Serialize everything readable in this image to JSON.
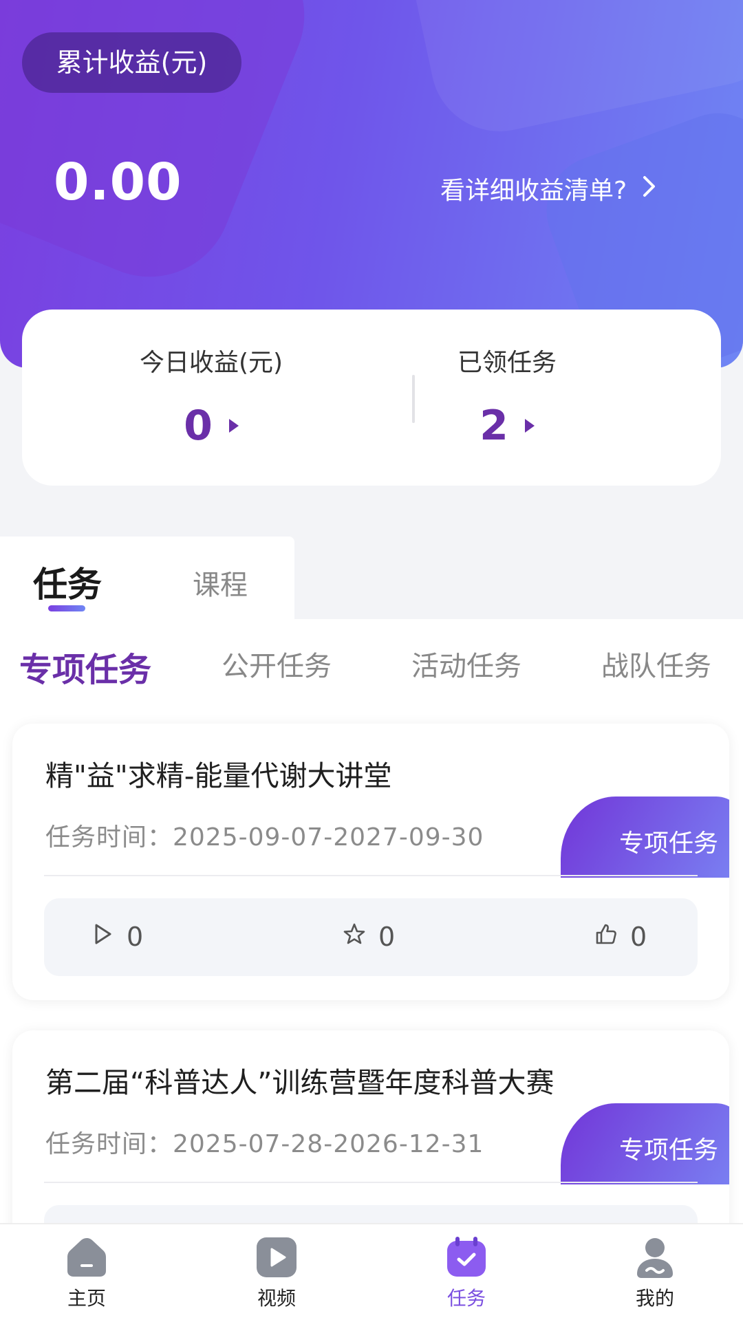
{
  "header": {
    "pill_label": "累计收益(元)",
    "total_earnings": "0.00",
    "detail_link": "看详细收益清单?"
  },
  "stats": {
    "today_label": "今日收益(元)",
    "today_value": "0",
    "tasks_label": "已领任务",
    "tasks_value": "2"
  },
  "tabs": {
    "active": "任务",
    "inactive": "课程"
  },
  "subtabs": [
    "专项任务",
    "公开任务",
    "活动任务",
    "战队任务"
  ],
  "tasks": [
    {
      "title": "精\"益\"求精-能量代谢大讲堂",
      "time": "任务时间：2025-09-07-2027-09-30",
      "badge": "专项任务",
      "plays": "0",
      "favorites": "0",
      "likes": "0"
    },
    {
      "title": "第二届“科普达人”训练营暨年度科普大赛",
      "time": "任务时间：2025-07-28-2026-12-31",
      "badge": "专项任务"
    }
  ],
  "nav": {
    "items": [
      {
        "label": "主页",
        "icon": "home-icon"
      },
      {
        "label": "视频",
        "icon": "video-icon"
      },
      {
        "label": "任务",
        "icon": "task-calendar-icon"
      },
      {
        "label": "我的",
        "icon": "profile-icon"
      }
    ],
    "active_color": "#7b4fe0"
  },
  "colors": {
    "accent": "#6a2fa8",
    "gradient_start": "#7a3fe0",
    "gradient_end": "#6f86f4"
  }
}
